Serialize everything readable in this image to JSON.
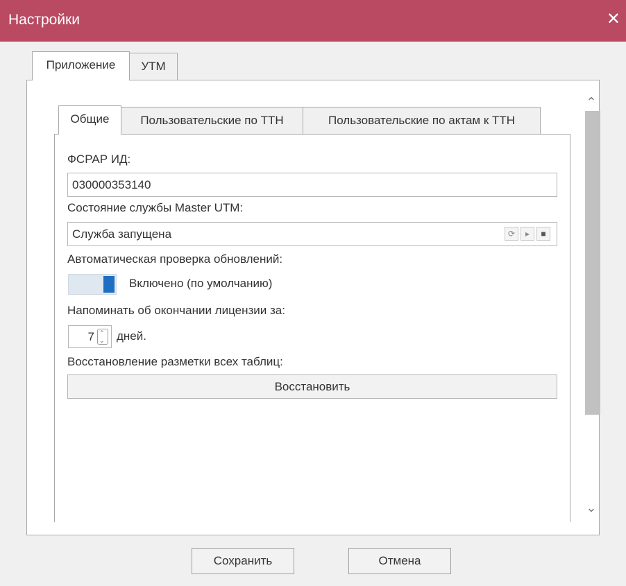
{
  "window": {
    "title": "Настройки",
    "close_glyph": "✕"
  },
  "outer_tabs": [
    {
      "label": "Приложение",
      "active": true
    },
    {
      "label": "УТМ",
      "active": false
    }
  ],
  "inner_tabs": [
    {
      "label": "Общие",
      "active": true
    },
    {
      "label": "Пользовательские по ТТН",
      "active": false
    },
    {
      "label": "Пользовательские по актам к ТТН",
      "active": false
    }
  ],
  "general": {
    "fsrar_label": "ФСРАР ИД:",
    "fsrar_value": "030000353140",
    "service_label": "Состояние службы Master UTM:",
    "service_value": "Служба запущена",
    "service_buttons": [
      "refresh-icon",
      "play-icon",
      "stop-icon"
    ],
    "autoupdate_label": "Автоматическая проверка обновлений:",
    "autoupdate_state": "Включено (по умолчанию)",
    "autoupdate_on": true,
    "license_label": "Напоминать об окончании лицензии за:",
    "license_days": "7",
    "license_unit": "дней.",
    "restore_label": "Восстановление разметки всех таблиц:",
    "restore_button": "Восстановить"
  },
  "footer": {
    "save": "Сохранить",
    "cancel": "Отмена"
  },
  "colors": {
    "titlebar": "#b94a62",
    "toggle_on": "#1e6fc2"
  }
}
